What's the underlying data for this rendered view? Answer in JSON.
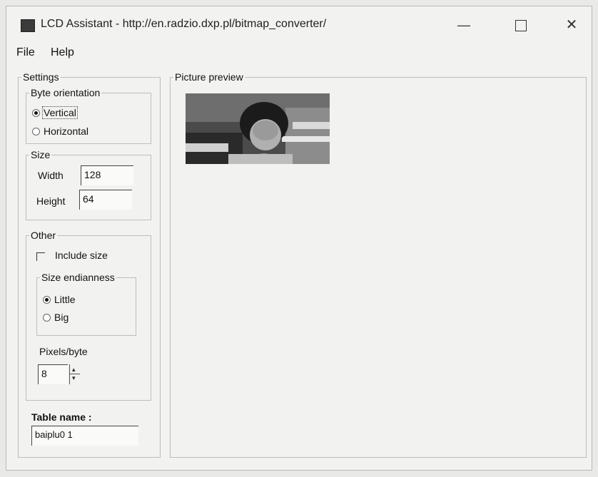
{
  "window": {
    "title": "LCD Assistant -  http://en.radzio.dxp.pl/bitmap_converter/",
    "controls": {
      "minimize": "—",
      "close": "✕"
    }
  },
  "menu": {
    "items": [
      "File",
      "Help"
    ]
  },
  "settings": {
    "legend": "Settings",
    "byte_orientation": {
      "legend": "Byte orientation",
      "options": [
        {
          "label": "Vertical",
          "selected": true
        },
        {
          "label": "Horizontal",
          "selected": false
        }
      ]
    },
    "size": {
      "legend": "Size",
      "width_label": "Width",
      "width_value": "128",
      "height_label": "Height",
      "height_value": "64"
    },
    "other": {
      "legend": "Other",
      "include_size_label": "Include size",
      "include_size_checked": false,
      "endianness": {
        "legend": "Size endianness",
        "options": [
          {
            "label": "Little",
            "selected": true
          },
          {
            "label": "Big",
            "selected": false
          }
        ]
      },
      "pixels_per_byte_label": "Pixels/byte",
      "pixels_per_byte_value": "8",
      "spin_up": "▴",
      "spin_down": "▾"
    },
    "table_name_label": "Table name :",
    "table_name_value": "baiplu0 1"
  },
  "preview": {
    "legend": "Picture preview",
    "image_description_icon": "preview-image"
  }
}
